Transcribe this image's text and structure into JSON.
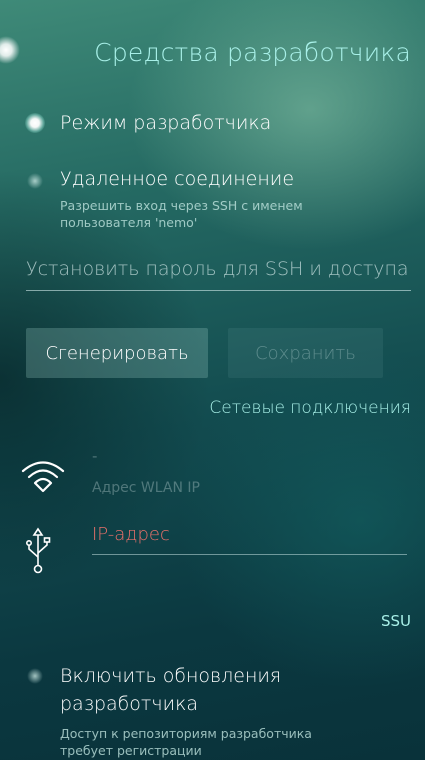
{
  "page": {
    "title": "Средства разработчика"
  },
  "developer_mode": {
    "label": "Режим разработчика",
    "enabled": true
  },
  "remote_connection": {
    "label": "Удаленное соединение",
    "description": "Разрешить вход через SSH с именем пользователя 'nemo'",
    "enabled": false
  },
  "password_field": {
    "placeholder": "Установить пароль для SSH и доступа"
  },
  "buttons": {
    "generate": "Сгенерировать",
    "save": "Сохранить"
  },
  "network": {
    "header": "Сетевые подключения",
    "wlan_value": "-",
    "wlan_label": "Адрес WLAN IP",
    "usb_label": "IP-адрес"
  },
  "ssu": {
    "header": "SSU",
    "developer_updates": {
      "label": "Включить обновления разработчика",
      "description": "Доступ к репозиториям разработчика требует регистрации",
      "enabled": false
    }
  },
  "colors": {
    "accent": "#a8f0e8",
    "error": "#e8706a",
    "background_top": "#3f8a78",
    "background_bottom": "#09323a"
  },
  "icons": {
    "wifi": "wifi-icon",
    "usb": "usb-icon",
    "pulley": "pulley-menu-indicator"
  }
}
